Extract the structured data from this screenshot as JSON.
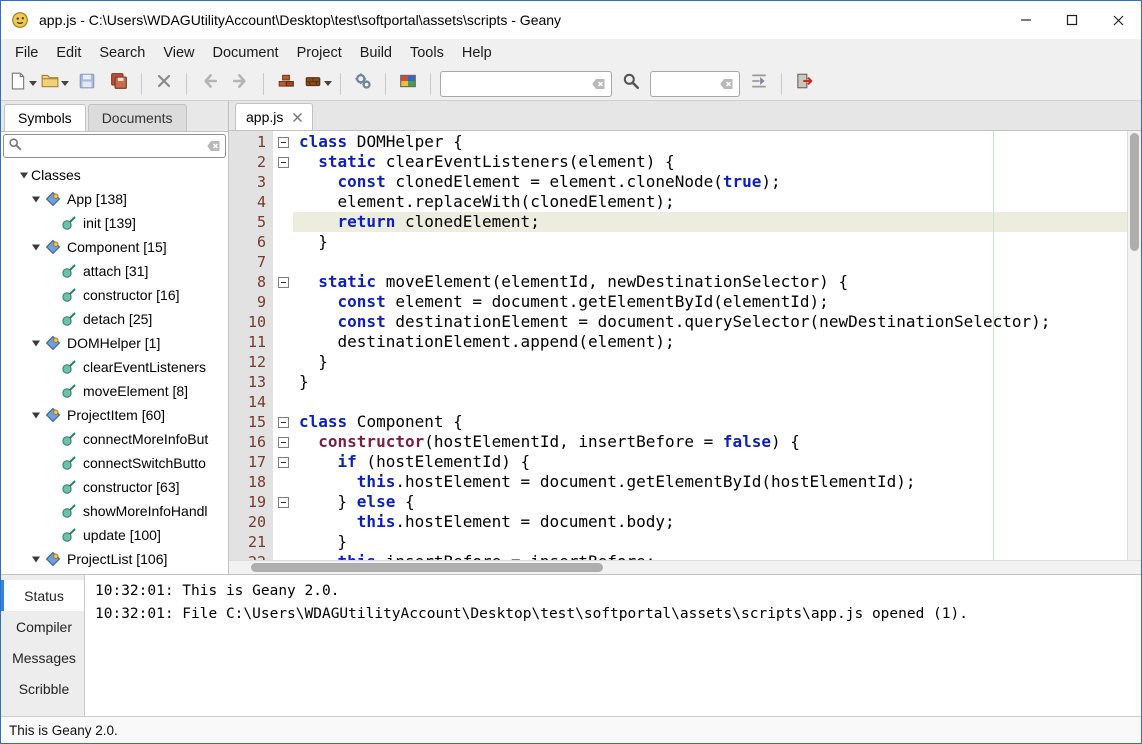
{
  "window": {
    "title": "app.js - C:\\Users\\WDAGUtilityAccount\\Desktop\\test\\softportal\\assets\\scripts - Geany"
  },
  "menubar": {
    "items": [
      "File",
      "Edit",
      "Search",
      "View",
      "Document",
      "Project",
      "Build",
      "Tools",
      "Help"
    ]
  },
  "toolbar": {
    "buttons": [
      "new-file",
      "open-file",
      "save",
      "save-all",
      "close-document",
      "navigate-back",
      "navigate-forward",
      "compile",
      "build",
      "run",
      "color-chooser",
      "search",
      "goto-line",
      "quit"
    ],
    "search": {
      "value": "",
      "placeholder": ""
    },
    "goto": {
      "value": "",
      "placeholder": ""
    }
  },
  "sidebar": {
    "tabs": [
      {
        "label": "Symbols"
      },
      {
        "label": "Documents"
      }
    ],
    "active_tab": "Symbols",
    "filter": {
      "value": "",
      "placeholder": ""
    },
    "tree": [
      {
        "level": 0,
        "label": "Classes",
        "expanded": true,
        "icon": "none"
      },
      {
        "level": 1,
        "label": "App [138]",
        "expanded": true,
        "icon": "class"
      },
      {
        "level": 2,
        "label": "init [139]",
        "icon": "method"
      },
      {
        "level": 1,
        "label": "Component [15]",
        "expanded": true,
        "icon": "class"
      },
      {
        "level": 2,
        "label": "attach [31]",
        "icon": "method"
      },
      {
        "level": 2,
        "label": "constructor [16]",
        "icon": "method"
      },
      {
        "level": 2,
        "label": "detach [25]",
        "icon": "method"
      },
      {
        "level": 1,
        "label": "DOMHelper [1]",
        "expanded": true,
        "icon": "class"
      },
      {
        "level": 2,
        "label": "clearEventListeners",
        "icon": "method"
      },
      {
        "level": 2,
        "label": "moveElement [8]",
        "icon": "method"
      },
      {
        "level": 1,
        "label": "ProjectItem [60]",
        "expanded": true,
        "icon": "class"
      },
      {
        "level": 2,
        "label": "connectMoreInfoBut",
        "icon": "method"
      },
      {
        "level": 2,
        "label": "connectSwitchButto",
        "icon": "method"
      },
      {
        "level": 2,
        "label": "constructor [63]",
        "icon": "method"
      },
      {
        "level": 2,
        "label": "showMoreInfoHandl",
        "icon": "method"
      },
      {
        "level": 2,
        "label": "update [100]",
        "icon": "method"
      },
      {
        "level": 1,
        "label": "ProjectList [106]",
        "expanded": true,
        "icon": "class"
      }
    ]
  },
  "editor": {
    "tab": "app.js",
    "current_line": 5,
    "fold_open_lines": [
      1,
      2,
      8,
      15,
      16,
      17,
      19
    ],
    "long_line_column": 72,
    "lines": [
      [
        [
          "class",
          "k"
        ],
        [
          " DOMHelper {",
          "p"
        ]
      ],
      [
        [
          "  ",
          "p"
        ],
        [
          "static",
          "k"
        ],
        [
          " clearEventListeners(element) {",
          "p"
        ]
      ],
      [
        [
          "    ",
          "p"
        ],
        [
          "const",
          "k"
        ],
        [
          " clonedElement = element.cloneNode(",
          "p"
        ],
        [
          "true",
          "k"
        ],
        [
          ");",
          "p"
        ]
      ],
      [
        [
          "    element.replaceWith(clonedElement);",
          "p"
        ]
      ],
      [
        [
          "    ",
          "p"
        ],
        [
          "return",
          "k"
        ],
        [
          " clonedElement;",
          "p"
        ]
      ],
      [
        [
          "  }",
          "p"
        ]
      ],
      [],
      [
        [
          "  ",
          "p"
        ],
        [
          "static",
          "k"
        ],
        [
          " moveElement(elementId, newDestinationSelector) {",
          "p"
        ]
      ],
      [
        [
          "    ",
          "p"
        ],
        [
          "const",
          "k"
        ],
        [
          " element = document.getElementById(elementId);",
          "p"
        ]
      ],
      [
        [
          "    ",
          "p"
        ],
        [
          "const",
          "k"
        ],
        [
          " destinationElement = document.querySelector(newDestinationSelector);",
          "p"
        ]
      ],
      [
        [
          "    destinationElement.append(element);",
          "p"
        ]
      ],
      [
        [
          "  }",
          "p"
        ]
      ],
      [
        [
          "}",
          "p"
        ]
      ],
      [],
      [
        [
          "class",
          "k"
        ],
        [
          " Component {",
          "p"
        ]
      ],
      [
        [
          "  ",
          "p"
        ],
        [
          "constructor",
          "k2"
        ],
        [
          "(hostElementId, insertBefore = ",
          "p"
        ],
        [
          "false",
          "k"
        ],
        [
          ") {",
          "p"
        ]
      ],
      [
        [
          "    ",
          "p"
        ],
        [
          "if",
          "k"
        ],
        [
          " (hostElementId) {",
          "p"
        ]
      ],
      [
        [
          "      ",
          "p"
        ],
        [
          "this",
          "k"
        ],
        [
          ".hostElement = document.getElementById(hostElementId);",
          "p"
        ]
      ],
      [
        [
          "    } ",
          "p"
        ],
        [
          "else",
          "k"
        ],
        [
          " {",
          "p"
        ]
      ],
      [
        [
          "      ",
          "p"
        ],
        [
          "this",
          "k"
        ],
        [
          ".hostElement = document.body;",
          "p"
        ]
      ],
      [
        [
          "    }",
          "p"
        ]
      ],
      [
        [
          "    ",
          "p"
        ],
        [
          "this",
          "k"
        ],
        [
          ".insertBefore = insertBefore;",
          "p"
        ]
      ]
    ]
  },
  "messages": {
    "tabs": [
      "Status",
      "Compiler",
      "Messages",
      "Scribble"
    ],
    "active_tab": "Status",
    "lines": [
      "10:32:01: This is Geany 2.0.",
      "10:32:01: File C:\\Users\\WDAGUtilityAccount\\Desktop\\test\\softportal\\assets\\scripts\\app.js opened (1)."
    ]
  },
  "statusbar": {
    "text": "This is Geany 2.0."
  },
  "colors": {
    "window_border": "#2f6fc4",
    "keyword": "#0c1fc0",
    "keyword2": "#7e1e3e",
    "line_number": "#75382b",
    "current_line_bg": "#ededdf",
    "long_line_marker": "#c9e4c9",
    "tab_indicator": "#3584e4"
  }
}
